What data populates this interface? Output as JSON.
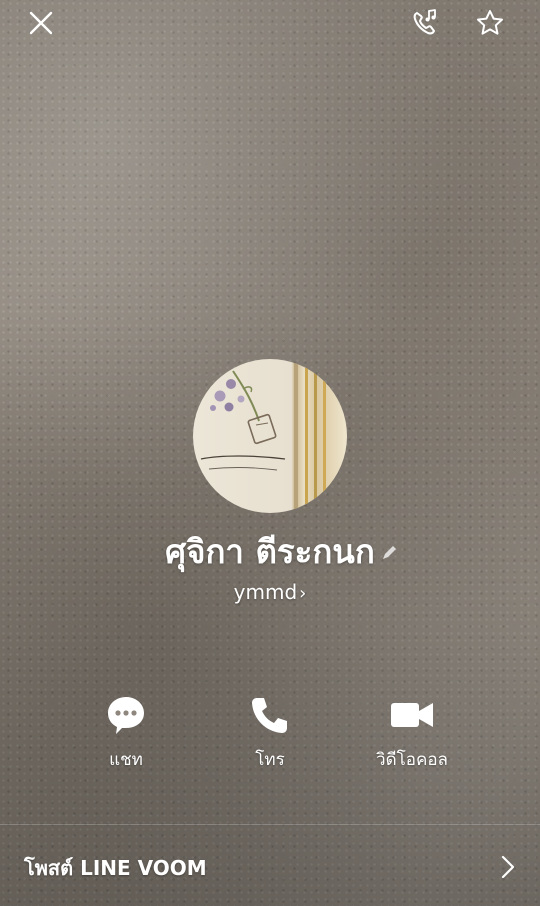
{
  "profile": {
    "name": "ศุจิกา ตีระกนก",
    "status": "ymmd",
    "status_chevron": "›"
  },
  "actions": [
    {
      "label": "แชท",
      "icon": "chat-bubble-icon"
    },
    {
      "label": "โทร",
      "icon": "phone-icon"
    },
    {
      "label": "วิดีโอคอล",
      "icon": "video-camera-icon"
    }
  ],
  "voom": {
    "label": "โพสต์ LINE VOOM"
  },
  "header_icons": [
    "close-icon",
    "ringtone-phone-icon",
    "star-icon"
  ],
  "colors": {
    "text": "#ffffff"
  }
}
